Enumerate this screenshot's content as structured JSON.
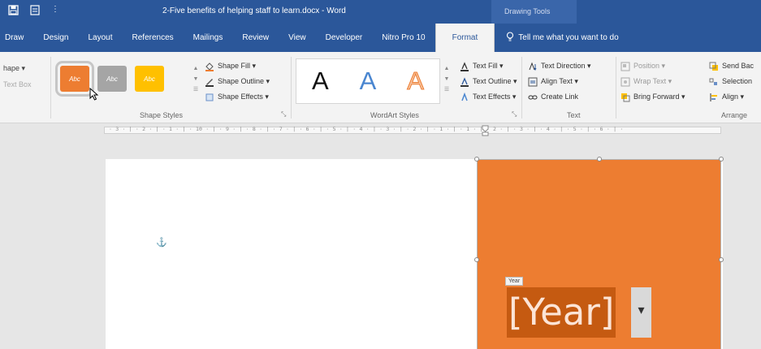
{
  "title_bar": {
    "document_title": "2-Five benefits of helping staff to learn.docx - Word",
    "context_tab": "Drawing Tools"
  },
  "tabs": [
    {
      "label": "Draw",
      "active": false
    },
    {
      "label": "Design",
      "active": false
    },
    {
      "label": "Layout",
      "active": false
    },
    {
      "label": "References",
      "active": false
    },
    {
      "label": "Mailings",
      "active": false
    },
    {
      "label": "Review",
      "active": false
    },
    {
      "label": "View",
      "active": false
    },
    {
      "label": "Developer",
      "active": false
    },
    {
      "label": "Nitro Pro 10",
      "active": false
    },
    {
      "label": "Format",
      "active": true
    }
  ],
  "tell_me": "Tell me what you want to do",
  "ribbon": {
    "insert_shapes": {
      "edit_shape": "hape ▾",
      "text_box": "Text Box"
    },
    "shape_styles": {
      "swatch_text": "Abc",
      "shape_fill": "Shape Fill ▾",
      "shape_outline": "Shape Outline ▾",
      "shape_effects": "Shape Effects ▾",
      "label": "Shape Styles"
    },
    "wordart_styles": {
      "letter": "A",
      "text_fill": "Text Fill ▾",
      "text_outline": "Text Outline ▾",
      "text_effects": "Text Effects ▾",
      "label": "WordArt Styles"
    },
    "text": {
      "text_direction": "Text Direction ▾",
      "align_text": "Align Text ▾",
      "create_link": "Create Link",
      "label": "Text"
    },
    "arrange": {
      "position": "Position ▾",
      "wrap_text": "Wrap Text ▾",
      "bring_forward": "Bring Forward ▾",
      "send_backward": "Send Bac",
      "selection_pane": "Selection",
      "align": "Align ▾",
      "label": "Arrange"
    }
  },
  "ruler_text": "· 3 · | · 2 · | · 1 · | · 10 · | · 9 · | · 8 · | · 7 · | · 6 · | · 5 · | · 4 · | · 3 · | · 2 · | · 1 · |       · 1 · | · 2 · | · 3 · | · 4 · | · 5 · | · 6 · | ·",
  "document": {
    "year_tag": "Year",
    "year_placeholder": "[Year]",
    "year_dropdown": "▾"
  },
  "colors": {
    "title_bar": "#2b579a",
    "shape_fill": "#ed7d31",
    "year_highlight": "#c55a11"
  }
}
